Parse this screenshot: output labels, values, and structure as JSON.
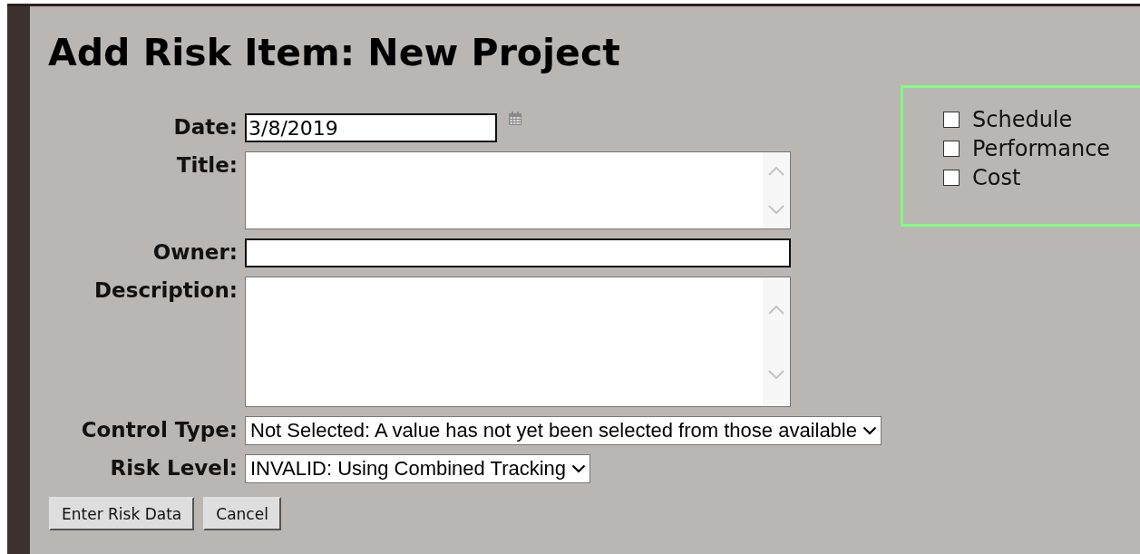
{
  "title": "Add Risk Item: New Project",
  "fields": [
    {
      "kind": "date",
      "label": "Date:",
      "value": "3/8/2019"
    },
    {
      "kind": "textarea",
      "label": "Title:"
    },
    {
      "kind": "text",
      "label": "Owner:"
    },
    {
      "kind": "memo",
      "label": "Description:"
    },
    {
      "kind": "select",
      "label": "Control Type:",
      "value": "Not Selected: A value has not yet been selected from those available"
    },
    {
      "kind": "select",
      "label": "Risk Level:",
      "value": "INVALID: Using Combined Tracking"
    }
  ],
  "categories": [
    {
      "label": "Schedule",
      "checked": false
    },
    {
      "label": "Performance",
      "checked": false
    },
    {
      "label": "Cost",
      "checked": false
    }
  ],
  "buttons": [
    "Enter Risk Data",
    "Cancel"
  ]
}
